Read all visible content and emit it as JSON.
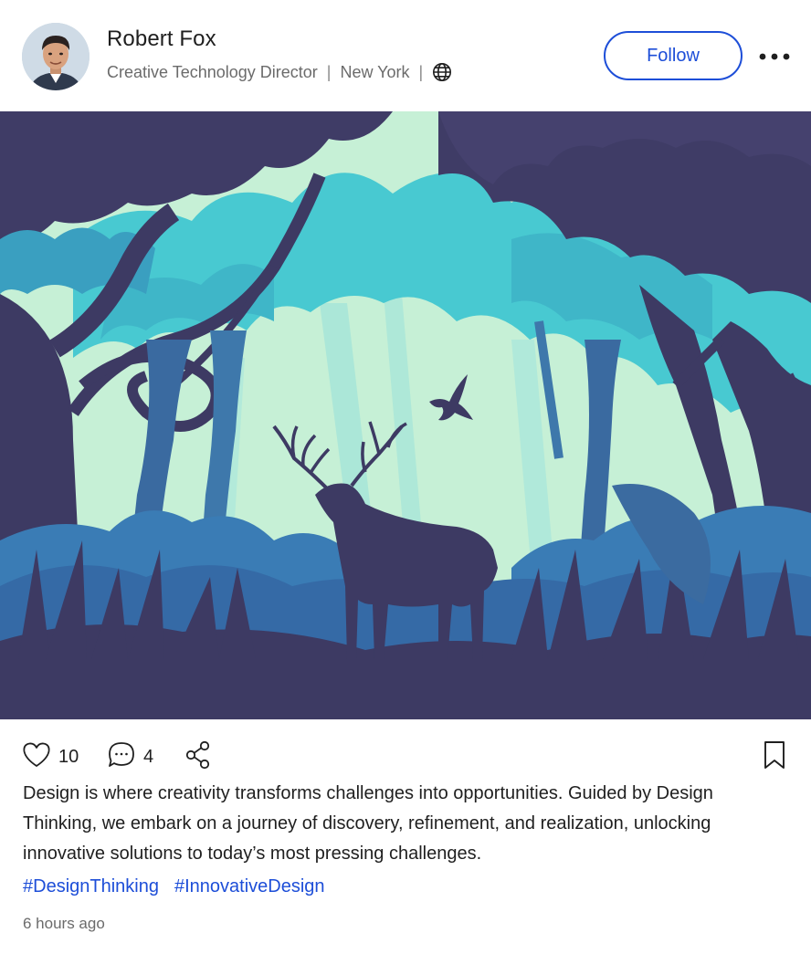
{
  "author": {
    "name": "Robert Fox",
    "title": "Creative Technology Director",
    "location": "New York",
    "separator": "|",
    "visibility_icon": "globe-icon"
  },
  "actions": {
    "follow_label": "Follow",
    "more_icon": "more-horizontal-icon",
    "like_count": "10",
    "comment_count": "4",
    "like_icon": "heart-icon",
    "comment_icon": "comment-icon",
    "share_icon": "share-icon",
    "bookmark_icon": "bookmark-icon"
  },
  "post": {
    "image_icon": "forest-deer-illustration",
    "caption": "Design is where creativity transforms challenges into opportunities. Guided by Design Thinking, we embark on a journey of discovery, refinement, and realization, unlocking innovative solutions to today’s most pressing challenges.",
    "hashtags": [
      "#DesignThinking",
      "#InnovativeDesign"
    ],
    "time_ago": "6 hours ago"
  },
  "colors": {
    "accent": "#1d4ed8",
    "text": "#1f1f1f",
    "muted": "#6b6b6b",
    "forest_dark": "#3d3a63",
    "forest_teal": "#46c9d3",
    "forest_light": "#c4efd3"
  }
}
